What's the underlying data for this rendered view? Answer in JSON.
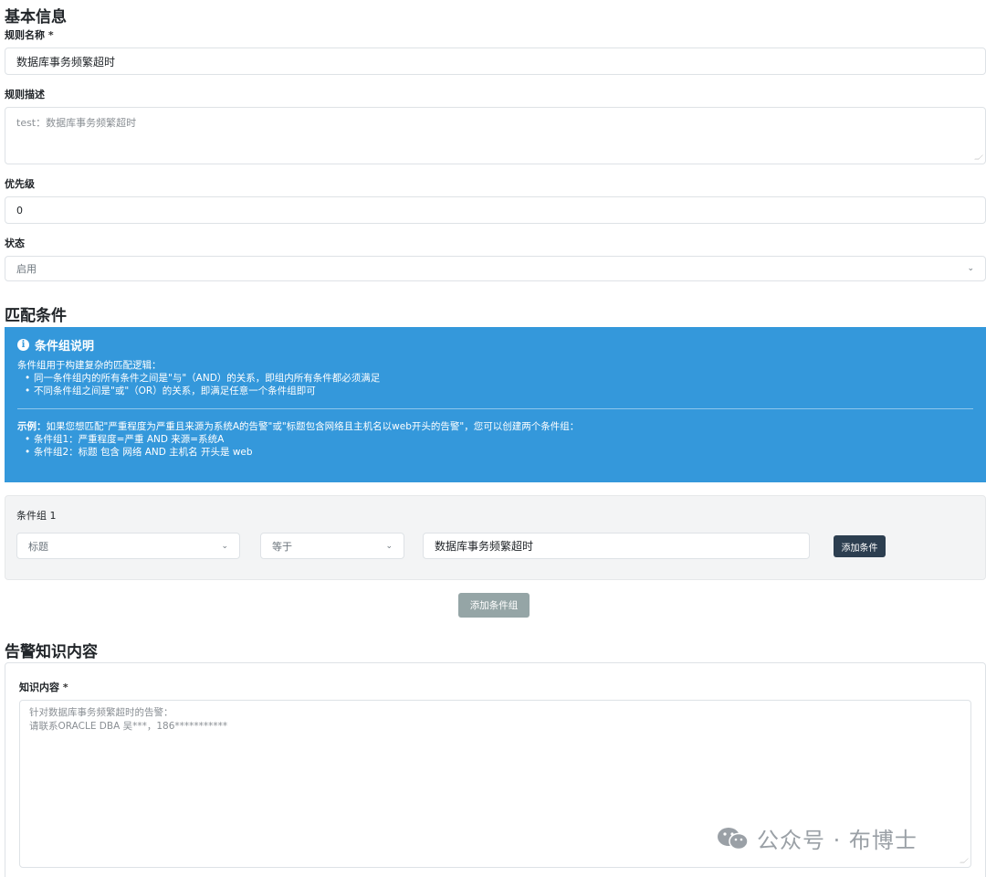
{
  "basic": {
    "section_title": "基本信息",
    "rule_name_label": "规则名称",
    "required_mark": "*",
    "rule_name_value": "数据库事务频繁超时",
    "rule_desc_label": "规则描述",
    "rule_desc_value": "test：数据库事务频繁超时",
    "priority_label": "优先级",
    "priority_value": "0",
    "status_label": "状态",
    "status_value": "启用"
  },
  "match": {
    "section_title": "匹配条件",
    "info": {
      "title": "条件组说明",
      "intro": "条件组用于构建复杂的匹配逻辑：",
      "bullets": [
        "同一条件组内的所有条件之间是\"与\"（AND）的关系，即组内所有条件都必须满足",
        "不同条件组之间是\"或\"（OR）的关系，即满足任意一个条件组即可"
      ],
      "example_label": "示例：",
      "example_text": "如果您想匹配\"严重程度为严重且来源为系统A的告警\"或\"标题包含网络且主机名以web开头的告警\"，您可以创建两个条件组：",
      "example_bullets": [
        "条件组1：严重程度=严重 AND 来源=系统A",
        "条件组2：标题 包含 网络 AND 主机名 开头是 web"
      ]
    },
    "group": {
      "title": "条件组 1",
      "field_value": "标题",
      "operator_value": "等于",
      "match_value": "数据库事务频繁超时",
      "add_condition_label": "添加条件"
    },
    "add_group_label": "添加条件组"
  },
  "knowledge": {
    "section_title": "告警知识内容",
    "label": "知识内容",
    "line1": "针对数据库事务频繁超时的告警：",
    "line2": "请联系ORACLE DBA 吴***，186***********"
  },
  "watermark": {
    "text": "公众号 · 布博士"
  },
  "icons": {
    "info": "info-circle-icon",
    "chevron": "chevron-down-icon",
    "wechat": "wechat-icon"
  },
  "colors": {
    "info_panel": "#3498db",
    "dark_button": "#2c3e50",
    "grey_button": "#95a5a6"
  }
}
